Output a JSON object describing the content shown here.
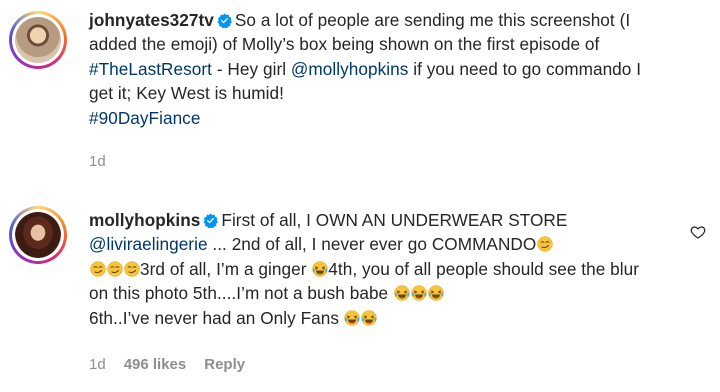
{
  "comments": [
    {
      "username": "johnyates327tv",
      "segments": [
        {
          "t": "So a lot of people are sending me this screenshot (I added the emoji) of Molly’s box being shown on the first episode of ",
          "link": false
        },
        {
          "t": "#TheLastResort",
          "link": true
        },
        {
          "t": " - Hey girl ",
          "link": false
        },
        {
          "t": "@mollyhopkins",
          "link": true
        },
        {
          "t": " if you need to go commando I get it; Key West is humid!",
          "link": false
        }
      ],
      "hashtag2": "#90DayFiance",
      "time": "1d"
    },
    {
      "username": "mollyhopkins",
      "p1": "First of all, I OWN AN UNDERWEAR STORE",
      "mention": "@liviraelingerie",
      "p2": " ... 2nd of all, I never ever go COMMANDO",
      "p3": "3rd of all, I’m a ginger ",
      "p4": "4th, you of all people should see the blur on this photo 5th....I’m not a bush babe ",
      "p5": "6th..I’ve never had an Only Fans ",
      "time": "1d",
      "likes": "496 likes",
      "reply": "Reply"
    }
  ],
  "icons": {
    "verified": "verified-badge-icon",
    "heart": "heart-outline-icon",
    "emoji_smirk": "smirk-emoji-icon",
    "emoji_laugh": "laughing-tears-emoji-icon"
  },
  "colors": {
    "link": "#00376b",
    "verified": "#0095f6",
    "muted": "#8e8e8e",
    "text": "#262626"
  }
}
